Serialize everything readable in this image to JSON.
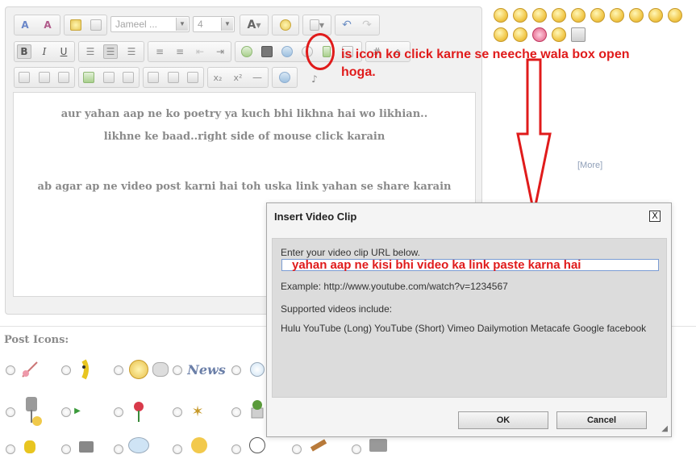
{
  "toolbar": {
    "font_name": "Jameel ...",
    "font_size": "4",
    "bold": "B",
    "italic": "I",
    "underline": "U",
    "subscript": "x₂",
    "superscript": "x²",
    "text_color": "A"
  },
  "editor": {
    "lines": [
      "aur yahan aap ne ko poetry ya kuch bhi likhna hai wo likhian..",
      "likhne ke baad..right side of mouse click karain",
      "ab agar ap ne video post karni hai toh uska link yahan se share karain"
    ]
  },
  "sidebar": {
    "more_link": "[More]"
  },
  "post_icons": {
    "label": "Post Icons:"
  },
  "annotation": {
    "text": "is icon ko click karne se neeche wala box open hoga.",
    "color": "#e01b1b"
  },
  "dialog": {
    "title": "Insert Video Clip",
    "close": "X",
    "instruction": "Enter your video clip URL below.",
    "url_value": "yahan aap ne kisi bhi video ka link paste karna hai",
    "example": "Example: http://www.youtube.com/watch?v=1234567",
    "supported_label": "Supported videos include:",
    "supported_list": "Hulu YouTube (Long) YouTube (Short) Vimeo Dailymotion Metacafe Google facebook",
    "ok": "OK",
    "cancel": "Cancel"
  }
}
